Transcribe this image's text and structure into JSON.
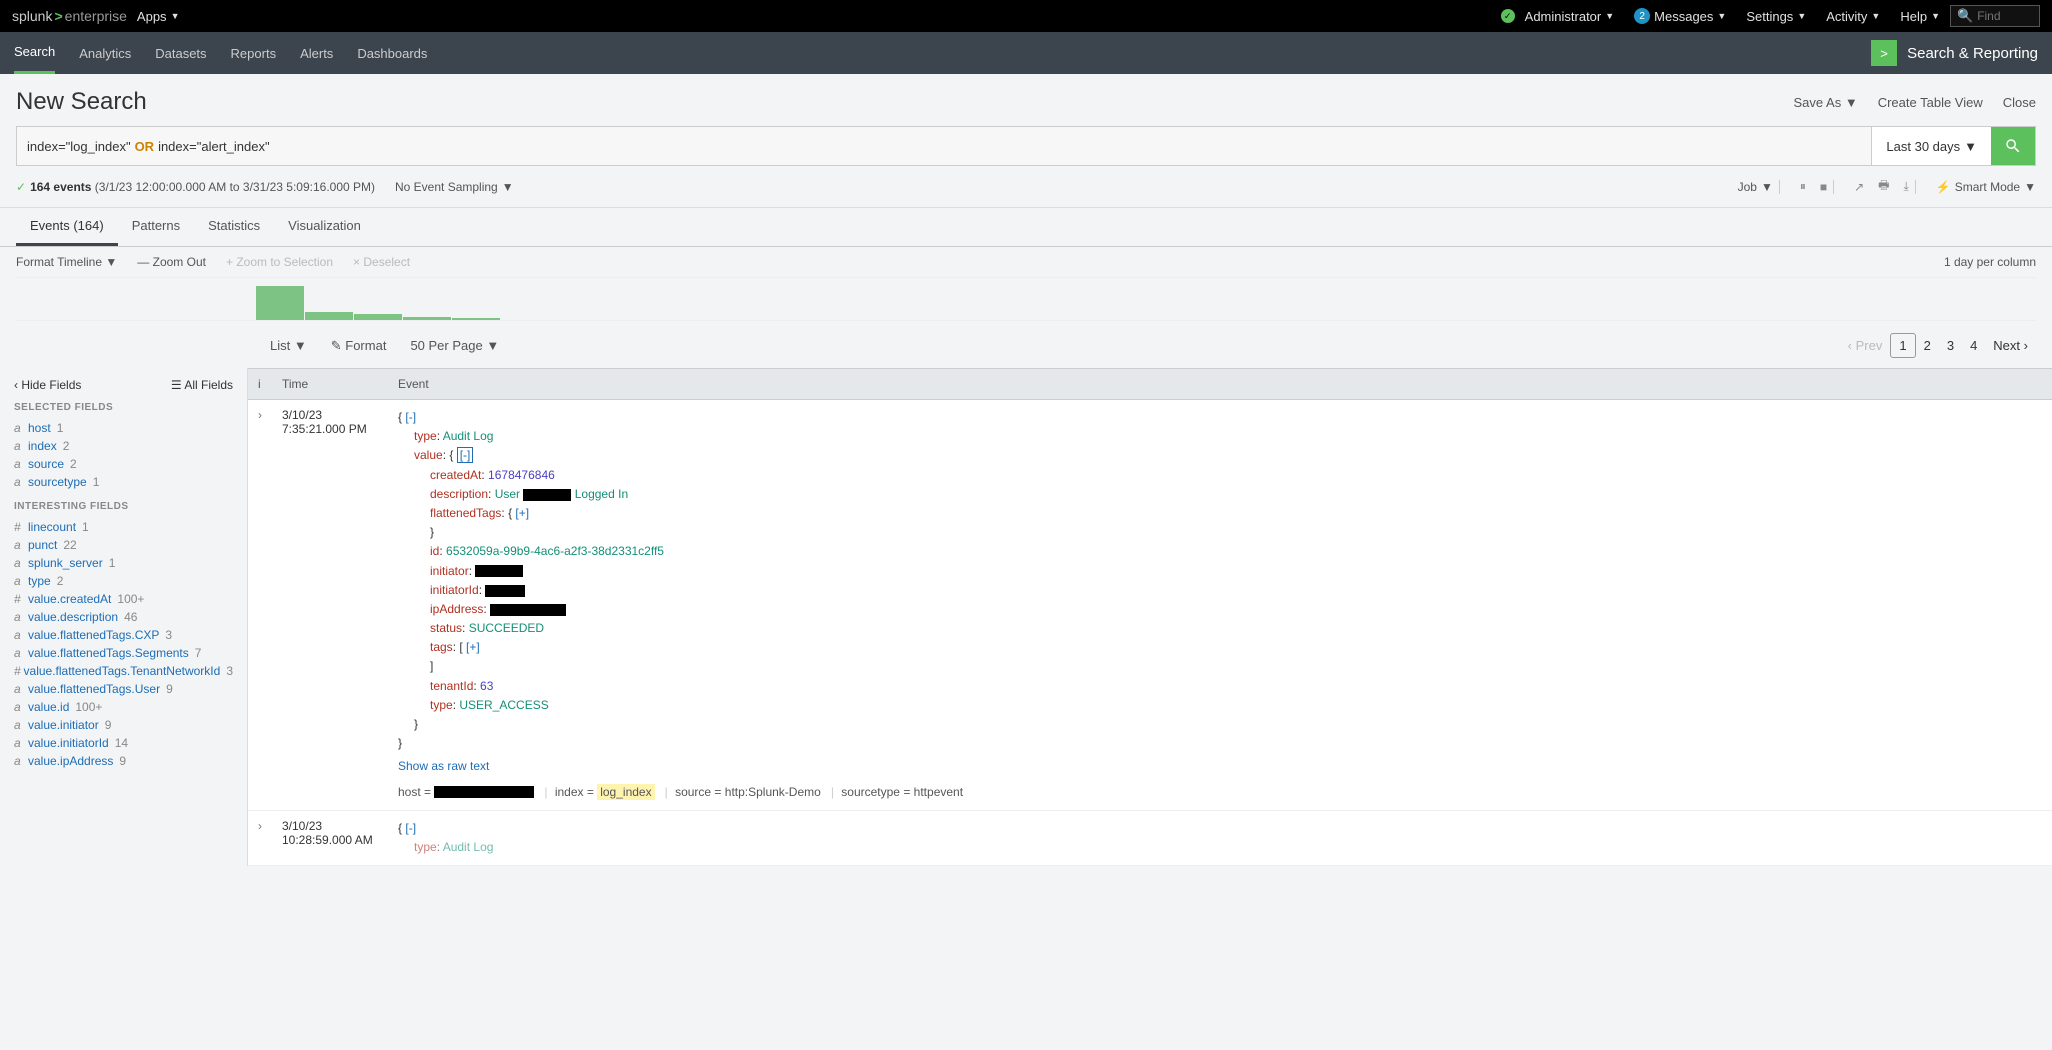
{
  "topbar": {
    "brand_prefix": "splunk",
    "brand_suffix": "enterprise",
    "apps": "Apps",
    "admin": "Administrator",
    "messages_count": "2",
    "messages": "Messages",
    "settings": "Settings",
    "activity": "Activity",
    "help": "Help",
    "find_placeholder": "Find"
  },
  "nav": {
    "items": [
      "Search",
      "Analytics",
      "Datasets",
      "Reports",
      "Alerts",
      "Dashboards"
    ],
    "app": "Search & Reporting"
  },
  "page": {
    "title": "New Search",
    "save_as": "Save As",
    "create_table": "Create Table View",
    "close": "Close"
  },
  "search": {
    "query_part1": "index=\"log_index\"",
    "query_or": "OR",
    "query_part2": "index=\"alert_index\"",
    "timerange": "Last 30 days"
  },
  "status": {
    "count": "164 events",
    "range": "(3/1/23 12:00:00.000 AM to 3/31/23 5:09:16.000 PM)",
    "sampling": "No Event Sampling",
    "job": "Job",
    "mode": "Smart Mode"
  },
  "rtabs": {
    "events": "Events (164)",
    "patterns": "Patterns",
    "stats": "Statistics",
    "viz": "Visualization"
  },
  "timeline": {
    "format": "Format Timeline",
    "zoom_out": "Zoom Out",
    "zoom_sel": "Zoom to Selection",
    "deselect": "Deselect",
    "perday": "1 day per column"
  },
  "viewbar": {
    "list": "List",
    "format": "Format",
    "perpage": "50 Per Page",
    "prev": "Prev",
    "pages": [
      "1",
      "2",
      "3",
      "4"
    ],
    "next": "Next"
  },
  "sidebar": {
    "hide": "Hide Fields",
    "all": "All Fields",
    "selected_title": "SELECTED FIELDS",
    "selected": [
      {
        "t": "a",
        "n": "host",
        "c": "1"
      },
      {
        "t": "a",
        "n": "index",
        "c": "2"
      },
      {
        "t": "a",
        "n": "source",
        "c": "2"
      },
      {
        "t": "a",
        "n": "sourcetype",
        "c": "1"
      }
    ],
    "interesting_title": "INTERESTING FIELDS",
    "interesting": [
      {
        "t": "#",
        "n": "linecount",
        "c": "1"
      },
      {
        "t": "a",
        "n": "punct",
        "c": "22"
      },
      {
        "t": "a",
        "n": "splunk_server",
        "c": "1"
      },
      {
        "t": "a",
        "n": "type",
        "c": "2"
      },
      {
        "t": "#",
        "n": "value.createdAt",
        "c": "100+"
      },
      {
        "t": "a",
        "n": "value.description",
        "c": "46"
      },
      {
        "t": "a",
        "n": "value.flattenedTags.CXP",
        "c": "3"
      },
      {
        "t": "a",
        "n": "value.flattenedTags.Segments",
        "c": "7"
      },
      {
        "t": "#",
        "n": "value.flattenedTags.TenantNetworkId",
        "c": "3"
      },
      {
        "t": "a",
        "n": "value.flattenedTags.User",
        "c": "9"
      },
      {
        "t": "a",
        "n": "value.id",
        "c": "100+"
      },
      {
        "t": "a",
        "n": "value.initiator",
        "c": "9"
      },
      {
        "t": "a",
        "n": "value.initiatorId",
        "c": "14"
      },
      {
        "t": "a",
        "n": "value.ipAddress",
        "c": "9"
      }
    ]
  },
  "events": {
    "col_i": "i",
    "col_time": "Time",
    "col_event": "Event",
    "row1": {
      "date": "3/10/23",
      "time": "7:35:21.000 PM",
      "type_key": "type",
      "type_val": "Audit Log",
      "value_key": "value",
      "createdAt_key": "createdAt",
      "createdAt_val": "1678476846",
      "description_key": "description",
      "description_pre": "User",
      "description_post": "Logged In",
      "flattenedTags_key": "flattenedTags",
      "id_key": "id",
      "id_val": "6532059a-99b9-4ac6-a2f3-38d2331c2ff5",
      "initiator_key": "initiator",
      "initiatorId_key": "initiatorId",
      "ipAddress_key": "ipAddress",
      "status_key": "status",
      "status_val": "SUCCEEDED",
      "tags_key": "tags",
      "tenantId_key": "tenantId",
      "tenantId_val": "63",
      "type2_key": "type",
      "type2_val": "USER_ACCESS",
      "raw": "Show as raw text",
      "m_host": "host =",
      "m_index_k": "index =",
      "m_index_v": "log_index",
      "m_source_k": "source =",
      "m_source_v": "http:Splunk-Demo",
      "m_sourcetype_k": "sourcetype =",
      "m_sourcetype_v": "httpevent"
    },
    "row2": {
      "date": "3/10/23",
      "time": "10:28:59.000 AM",
      "type_key": "type",
      "type_val": "Audit Log"
    }
  }
}
